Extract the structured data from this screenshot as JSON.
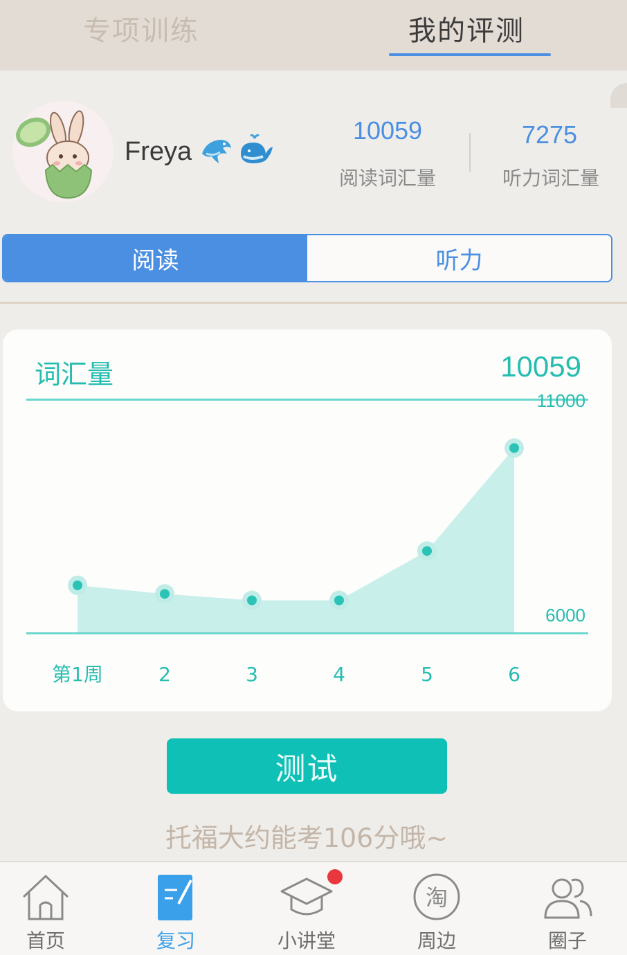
{
  "top_tabs": [
    {
      "label": "专项训练",
      "active": false
    },
    {
      "label": "我的评测",
      "active": true
    }
  ],
  "profile": {
    "username": "Freya",
    "emoji_icons": [
      "dolphin-icon",
      "whale-icon"
    ],
    "stats": [
      {
        "value": "10059",
        "label": "阅读词汇量"
      },
      {
        "value": "7275",
        "label": "听力词汇量"
      }
    ]
  },
  "segments": [
    {
      "label": "阅读",
      "active": true
    },
    {
      "label": "听力",
      "active": false
    }
  ],
  "chart_card": {
    "title": "词汇量",
    "value": "10059"
  },
  "chart_data": {
    "type": "area",
    "categories": [
      "第1周",
      "2",
      "3",
      "4",
      "5",
      "6"
    ],
    "values": [
      7100,
      6900,
      6750,
      6750,
      7900,
      10300
    ],
    "ylim": [
      6000,
      11000
    ],
    "y_tick_labels": [
      "11000",
      "6000"
    ],
    "grid": false,
    "colors": {
      "line": "#26bdb1",
      "fill": "#c9efeb",
      "point": "#2bc3b6"
    }
  },
  "test_button": {
    "label": "测试"
  },
  "hint_text": "托福大约能考106分哦~",
  "bottom_nav": [
    {
      "label": "首页",
      "icon": "home-icon",
      "active": false
    },
    {
      "label": "复习",
      "icon": "review-icon",
      "active": true
    },
    {
      "label": "小讲堂",
      "icon": "graduation-cap-icon",
      "active": false,
      "badge": true
    },
    {
      "label": "周边",
      "icon": "taobao-icon",
      "icon_text": "淘",
      "active": false
    },
    {
      "label": "圈子",
      "icon": "group-icon",
      "active": false
    }
  ],
  "colors": {
    "accent_blue": "#4a8fe2",
    "teal": "#26bdb1",
    "test_button": "#0fc0b6",
    "badge_red": "#e8383d"
  }
}
